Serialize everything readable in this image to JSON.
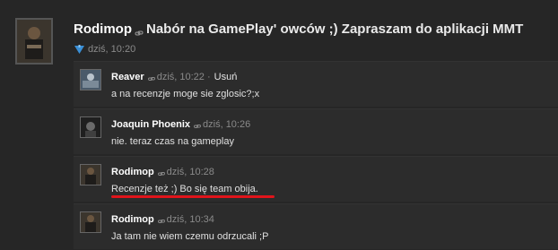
{
  "post": {
    "author": "Rodimop",
    "title": "Nabór na GamePlay' owców ;) Zapraszam do aplikacji MMT",
    "time": "dziś, 10:20"
  },
  "comments": [
    {
      "author": "Reaver",
      "time": "dziś, 10:22",
      "action": "Usuń",
      "text": "a na recenzje moge sie zglosic?;x"
    },
    {
      "author": "Joaquin Phoenix",
      "time": "dziś, 10:26",
      "text": "nie. teraz czas na gameplay"
    },
    {
      "author": "Rodimop",
      "time": "dziś, 10:28",
      "text": "Recenzje też ;) Bo się team obija."
    },
    {
      "author": "Rodimop",
      "time": "dziś, 10:34",
      "text": "Ja tam nie wiem czemu odrzucali ;P"
    }
  ],
  "colors": {
    "background": "#262626",
    "comment_background": "#2c2c2c",
    "highlight_underline": "#e0141b",
    "share_icon": "#3a8fd6"
  },
  "icons": {
    "link": "link-icon",
    "share": "share-icon"
  }
}
